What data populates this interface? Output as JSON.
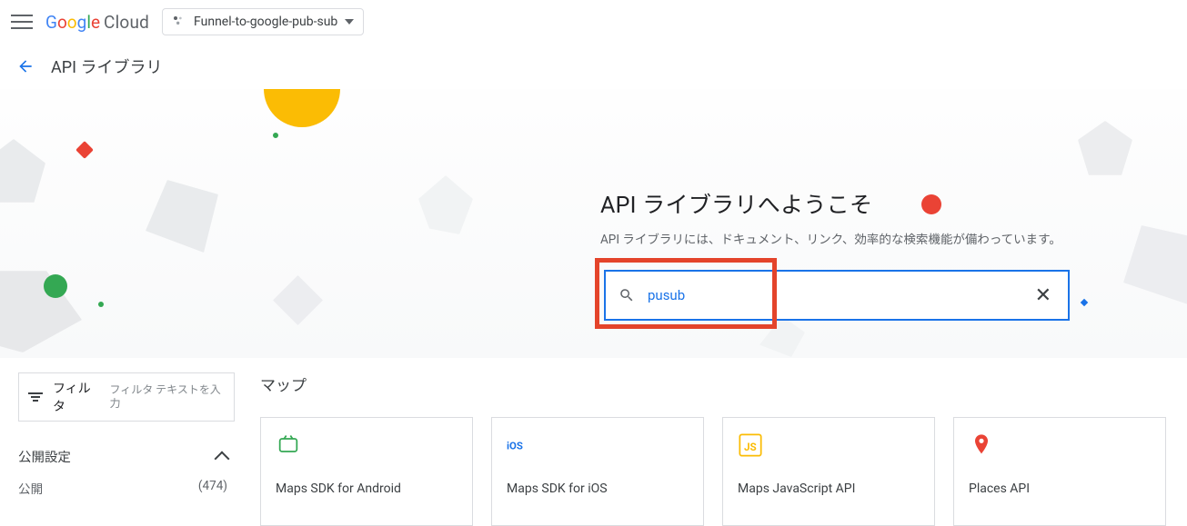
{
  "header": {
    "product_name_google": "Google",
    "product_name_cloud": "Cloud",
    "project_name": "Funnel-to-google-pub-sub"
  },
  "subheader": {
    "page_title": "API ライブラリ"
  },
  "hero": {
    "title": "API ライブラリへようこそ",
    "subtitle": "API ライブラリには、ドキュメント、リンク、効率的な検索機能が備わっています。",
    "search_value": "pusub"
  },
  "sidebar": {
    "filter_label": "フィルタ",
    "filter_placeholder": "フィルタ テキストを入力",
    "section_title": "公開設定",
    "rows": [
      {
        "label": "公開",
        "count": "(474)"
      }
    ]
  },
  "content": {
    "category_title": "マップ",
    "cards": [
      {
        "id": "maps-sdk-android",
        "title": "Maps SDK for Android"
      },
      {
        "id": "maps-sdk-ios",
        "title": "Maps SDK for iOS"
      },
      {
        "id": "maps-js-api",
        "title": "Maps JavaScript API"
      },
      {
        "id": "places-api",
        "title": "Places API"
      }
    ]
  }
}
